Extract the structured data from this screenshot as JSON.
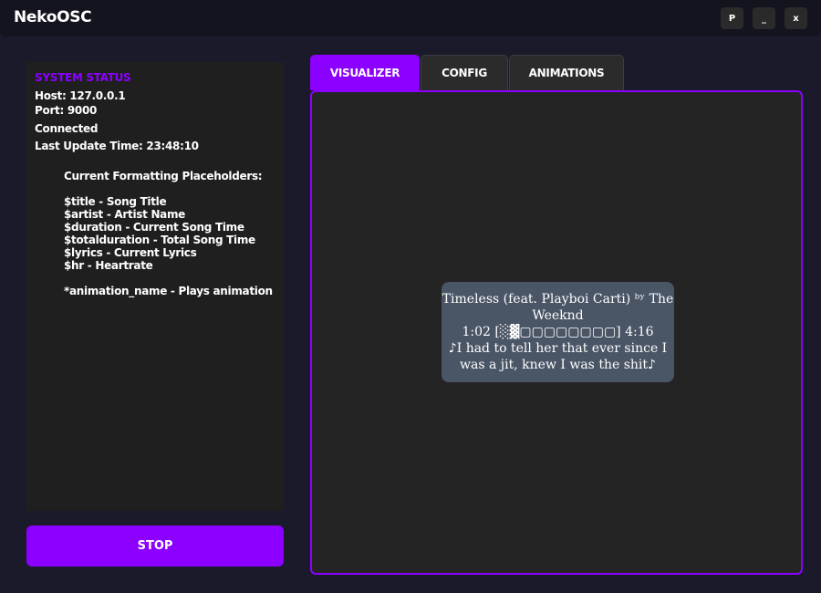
{
  "window": {
    "title": "NekoOSC",
    "buttons": [
      "P",
      "_",
      "x"
    ]
  },
  "status": {
    "heading": "SYSTEM STATUS",
    "host": "Host: 127.0.0.1",
    "port": "Port: 9000",
    "connection": "Connected",
    "last_update": "Last Update Time: 23:48:10",
    "placeholders_title": "Current Formatting Placeholders:",
    "placeholders": [
      "$title - Song Title",
      "$artist - Artist Name",
      "$duration - Current Song Time",
      "$totalduration - Total Song Time",
      "$lyrics - Current Lyrics",
      "$hr - Heartrate"
    ],
    "animation_note": "*animation_name - Plays animation"
  },
  "stop_label": "STOP",
  "tabs": [
    {
      "label": "VISUALIZER",
      "active": true
    },
    {
      "label": "CONFIG",
      "active": false
    },
    {
      "label": "ANIMATIONS",
      "active": false
    }
  ],
  "now_playing": {
    "line1": "Timeless (feat. Playboi Carti) ᵇʸ The",
    "line2": "Weeknd",
    "line3": "1:02 [░▓▢▢▢▢▢▢▢▢] 4:16",
    "line4": "♪I had to tell her that ever since I",
    "line5": "was a jit, knew I was the shit♪"
  },
  "colors": {
    "accent": "#8b00ff",
    "background": "#1a1a2a",
    "panel": "#1f1f1f",
    "card": "#4a5566"
  }
}
